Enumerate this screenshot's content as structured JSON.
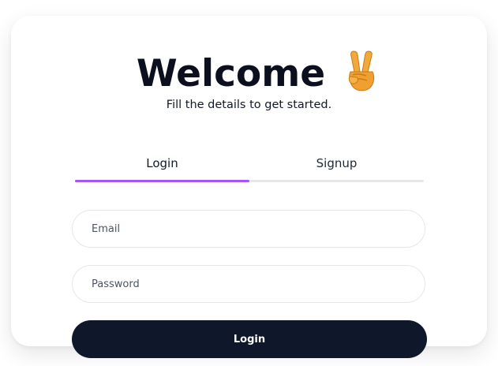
{
  "header": {
    "title": "Welcome",
    "emoji": "victory-hand-emoji",
    "subtitle": "Fill the details to get started."
  },
  "tabs": [
    {
      "label": "Login",
      "active": true
    },
    {
      "label": "Signup",
      "active": false
    }
  ],
  "form": {
    "email": {
      "value": "",
      "placeholder": "Email"
    },
    "password": {
      "value": "",
      "placeholder": "Password"
    },
    "submit_label": "Login"
  },
  "colors": {
    "accent": "#a855f7",
    "button": "#0f172a",
    "title": "#0b0f1e"
  }
}
